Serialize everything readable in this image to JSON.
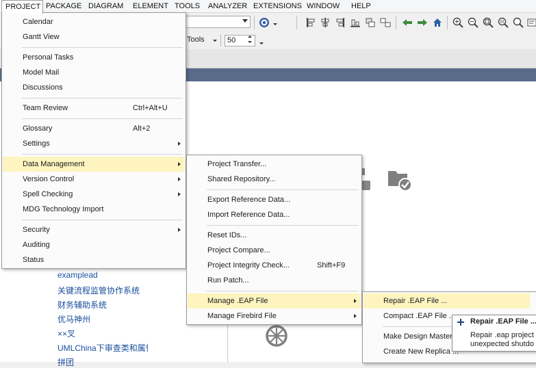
{
  "menubar": [
    "PROJECT",
    "PACKAGE",
    "DIAGRAM",
    "ELEMENT",
    "TOOLS",
    "ANALYZER",
    "EXTENSIONS",
    "WINDOW",
    "HELP"
  ],
  "toolbar": {
    "tools_label": "Tools",
    "zoom_value": "50"
  },
  "project_menu": [
    {
      "label": "Calendar"
    },
    {
      "label": "Gantt View"
    },
    {
      "label": "Personal Tasks"
    },
    {
      "label": "Model Mail"
    },
    {
      "label": "Discussions"
    },
    {
      "label": "Team Review",
      "shortcut": "Ctrl+Alt+U"
    },
    {
      "label": "Glossary",
      "shortcut": "Alt+2"
    },
    {
      "label": "Settings"
    },
    {
      "label": "Data Management"
    },
    {
      "label": "Version Control"
    },
    {
      "label": "Spell Checking"
    },
    {
      "label": "MDG Technology Import"
    },
    {
      "label": "Security"
    },
    {
      "label": "Auditing"
    },
    {
      "label": "Status"
    }
  ],
  "data_management_menu": [
    {
      "label": "Project Transfer..."
    },
    {
      "label": "Shared Repository..."
    },
    {
      "label": "Export Reference Data..."
    },
    {
      "label": "Import Reference Data..."
    },
    {
      "label": "Reset IDs..."
    },
    {
      "label": "Project Compare..."
    },
    {
      "label": "Project Integrity Check...",
      "shortcut": "Shift+F9"
    },
    {
      "label": "Run Patch..."
    },
    {
      "label": "Manage .EAP File"
    },
    {
      "label": "Manage Firebird File"
    }
  ],
  "eap_menu": [
    {
      "label": "Repair .EAP File ..."
    },
    {
      "label": "Compact .EAP File ..."
    },
    {
      "label": "Make Design Master"
    },
    {
      "label": "Create New Replica ..."
    }
  ],
  "tooltip": {
    "title": "Repair .EAP File ...",
    "line1": "Repair .eap project",
    "line2": "unexpected shutdo"
  },
  "recent_projects": [
    "examplead",
    "关键流程监管协作系统",
    "财务辅助系统",
    "优马神州",
    "××叉",
    "UMLChina下审查类和属性",
    "拼团"
  ]
}
